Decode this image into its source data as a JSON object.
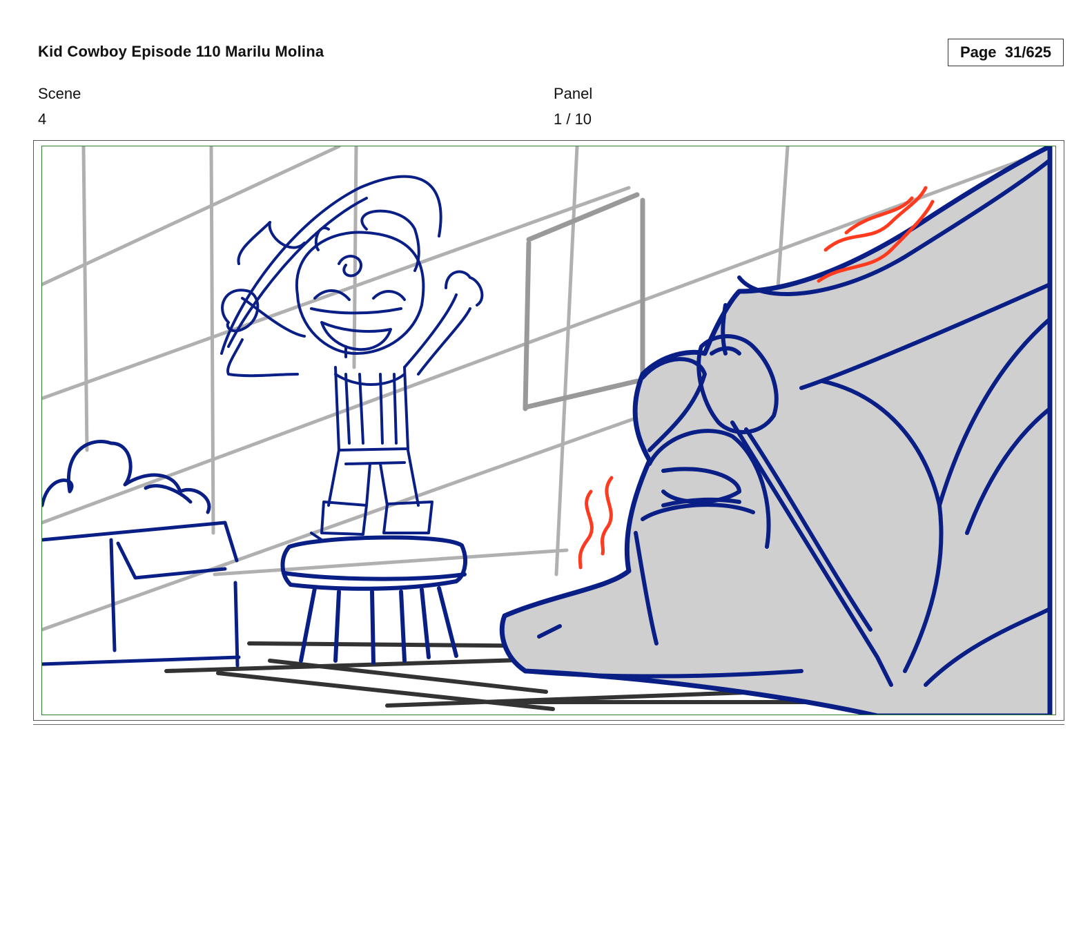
{
  "document": {
    "title": "Kid Cowboy Episode 110 Marilu Molina",
    "page": "Page  31/625"
  },
  "scene": {
    "label": "Scene",
    "value": "4"
  },
  "panel": {
    "label": "Panel",
    "value": "1 / 10"
  },
  "colors": {
    "ink": "#0a1f86",
    "wall_grid": "#b0b0b0",
    "floor_lines": "#333333",
    "heat_marks": "#ff3b1f",
    "shoe_fill": "#cfcfcf",
    "frame_border": "#2e7d32"
  }
}
